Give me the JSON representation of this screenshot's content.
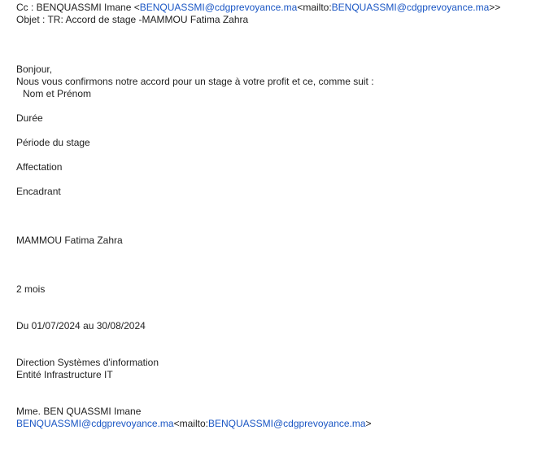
{
  "header": {
    "cc_label": "Cc : ",
    "cc_name": "BENQUASSMI Imane <",
    "cc_email": "BENQUASSMI@cdgprevoyance.ma",
    "cc_mailto_prefix": "<mailto:",
    "cc_mailto_email": "BENQUASSMI@cdgprevoyance.ma",
    "cc_close": ">>",
    "subject": "Objet : TR: Accord de stage -MAMMOU Fatima Zahra"
  },
  "body": {
    "greeting": "Bonjour,",
    "intro": "Nous vous confirmons notre accord pour un stage à votre profit et ce, comme suit :",
    "fields": {
      "nom_label": "Nom et  Prénom",
      "duree_label": "Durée",
      "periode_label": "Période du  stage",
      "affectation_label": "Affectation",
      "encadrant_label": "Encadrant"
    },
    "values": {
      "nom": "MAMMOU Fatima Zahra",
      "duree": "2 mois",
      "periode": "Du 01/07/2024 au 30/08/2024",
      "affectation_line1": "Direction Systèmes d'information",
      "affectation_line2": "Entité Infrastructure IT",
      "encadrant_name": "Mme. BEN QUASSMI Imane",
      "encadrant_email": "BENQUASSMI@cdgprevoyance.ma",
      "encadrant_mailto_prefix": "<mailto:",
      "encadrant_mailto_email": "BENQUASSMI@cdgprevoyance.ma",
      "encadrant_close": ">"
    }
  },
  "colors": {
    "link": "#1a56c4",
    "text": "#1f1f1f",
    "background": "#ffffff"
  }
}
